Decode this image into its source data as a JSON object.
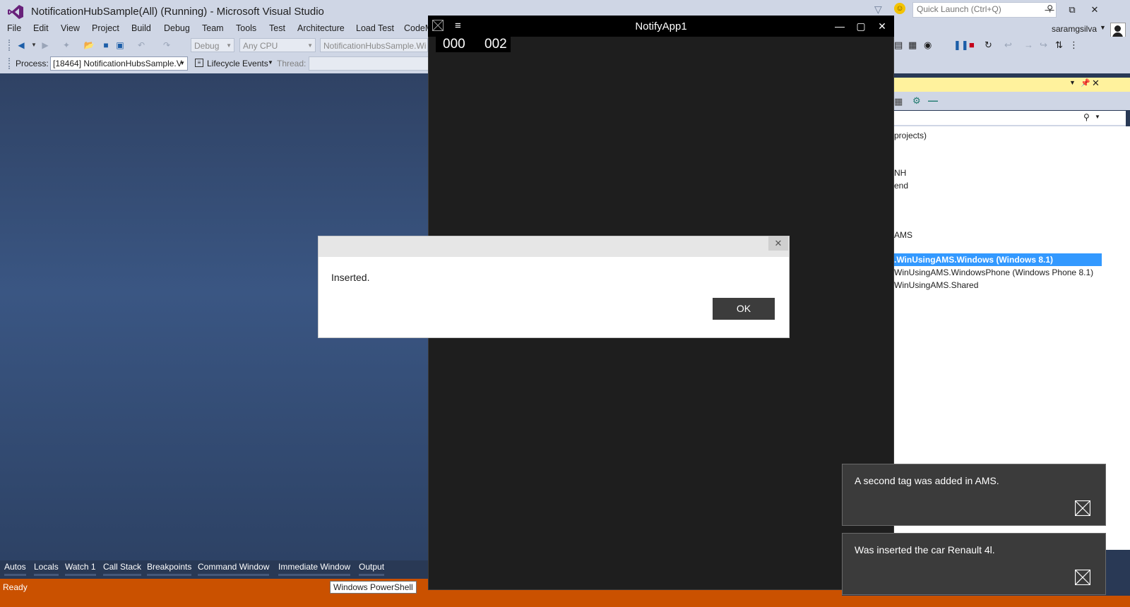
{
  "vs": {
    "title": "NotificationHubSample(All) (Running) - Microsoft Visual Studio",
    "quick_launch_placeholder": "Quick Launch (Ctrl+Q)",
    "menu": [
      "File",
      "Edit",
      "View",
      "Project",
      "Build",
      "Debug",
      "Team",
      "Tools",
      "Test",
      "Architecture",
      "Load Test",
      "CodeM"
    ],
    "user": "saramgsilva",
    "toolbar": {
      "config": "Debug",
      "platform": "Any CPU",
      "startup": "NotificationHubsSample.Wi"
    },
    "debug_location": {
      "process_label": "Process:",
      "process_value": "[18464] NotificationHubsSample.V",
      "lifecycle_label": "Lifecycle Events",
      "thread_label": "Thread:"
    },
    "solution_explorer": {
      "items": [
        "projects)",
        "NH",
        "end",
        "AMS",
        ".WinUsingAMS.Windows (Windows 8.1)",
        "WinUsingAMS.WindowsPhone (Windows Phone 8.1)",
        "WinUsingAMS.Shared"
      ],
      "selected_index": 4
    },
    "tool_tabs": [
      "Autos",
      "Locals",
      "Watch 1",
      "Call Stack",
      "Breakpoints",
      "Command Window",
      "Immediate Window",
      "Output"
    ],
    "status": "Ready",
    "taskbar_tooltip": "Windows PowerShell"
  },
  "app": {
    "title": "NotifyApp1",
    "tags": [
      "000",
      "002"
    ]
  },
  "dialog": {
    "message": "Inserted.",
    "ok_label": "OK"
  },
  "toasts": [
    {
      "text": "A second tag was added in AMS."
    },
    {
      "text": "Was inserted the car Renault 4l."
    }
  ],
  "colors": {
    "status_bar": "#ca5100",
    "selection": "#3399ff",
    "tool_window_header": "#fff29d"
  }
}
